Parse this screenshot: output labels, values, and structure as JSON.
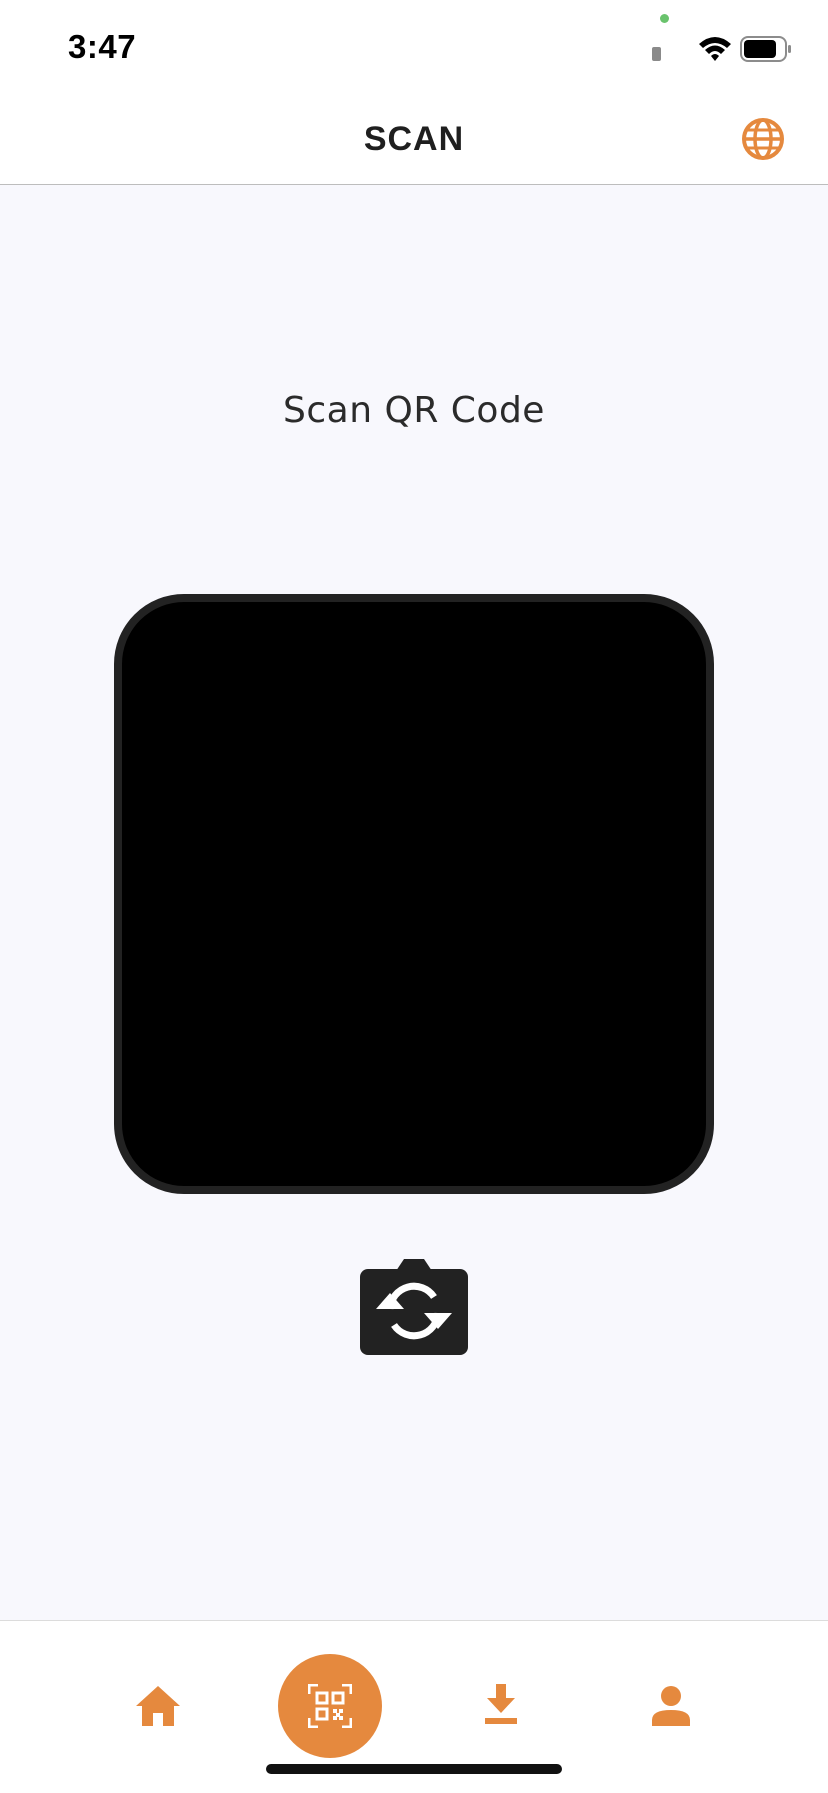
{
  "status_bar": {
    "time": "3:47"
  },
  "header": {
    "title": "SCAN",
    "language_icon": "globe-icon"
  },
  "main": {
    "heading": "Scan QR Code",
    "camera_preview": "camera-viewfinder",
    "switch_camera_icon": "switch-camera-icon"
  },
  "tab_bar": {
    "items": [
      {
        "icon": "home-icon",
        "active": false
      },
      {
        "icon": "qr-code-icon",
        "active": true
      },
      {
        "icon": "download-icon",
        "active": false
      },
      {
        "icon": "profile-icon",
        "active": false
      }
    ]
  },
  "colors": {
    "accent": "#e5893e",
    "background": "#f8f8fd",
    "header_background": "#ffffff",
    "camera_frame": "#222222",
    "camera_button": "#222222"
  }
}
